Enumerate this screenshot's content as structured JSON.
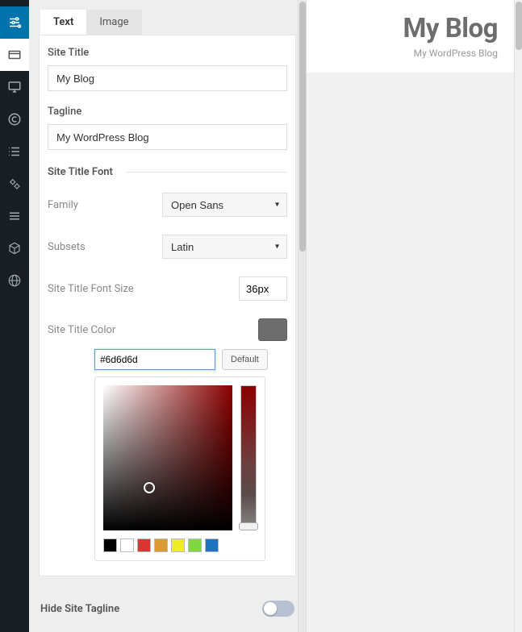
{
  "iconbar": {
    "items": [
      {
        "name": "sliders-icon"
      },
      {
        "name": "card-icon"
      },
      {
        "name": "monitor-icon"
      },
      {
        "name": "copyright-icon"
      },
      {
        "name": "list-icon"
      },
      {
        "name": "gears-icon"
      },
      {
        "name": "menu-icon"
      },
      {
        "name": "box-icon"
      },
      {
        "name": "globe-icon"
      }
    ]
  },
  "tabs": {
    "text": "Text",
    "image": "Image"
  },
  "form": {
    "site_title_label": "Site Title",
    "site_title_value": "My Blog",
    "tagline_label": "Tagline",
    "tagline_value": "My WordPress Blog",
    "font_section": "Site Title Font",
    "family_label": "Family",
    "family_value": "Open Sans",
    "subsets_label": "Subsets",
    "subsets_value": "Latin",
    "font_size_label": "Site Title Font Size",
    "font_size_value": "36px",
    "color_label": "Site Title Color",
    "color_hex": "#6d6d6d",
    "default_btn": "Default",
    "swatch_colors": [
      "#000000",
      "#ffffff",
      "#dd3333",
      "#dd9933",
      "#eeee22",
      "#81d742",
      "#1e73be"
    ],
    "hide_tagline_label": "Hide Site Tagline"
  },
  "preview": {
    "title": "My Blog",
    "tagline": "My WordPress Blog"
  }
}
